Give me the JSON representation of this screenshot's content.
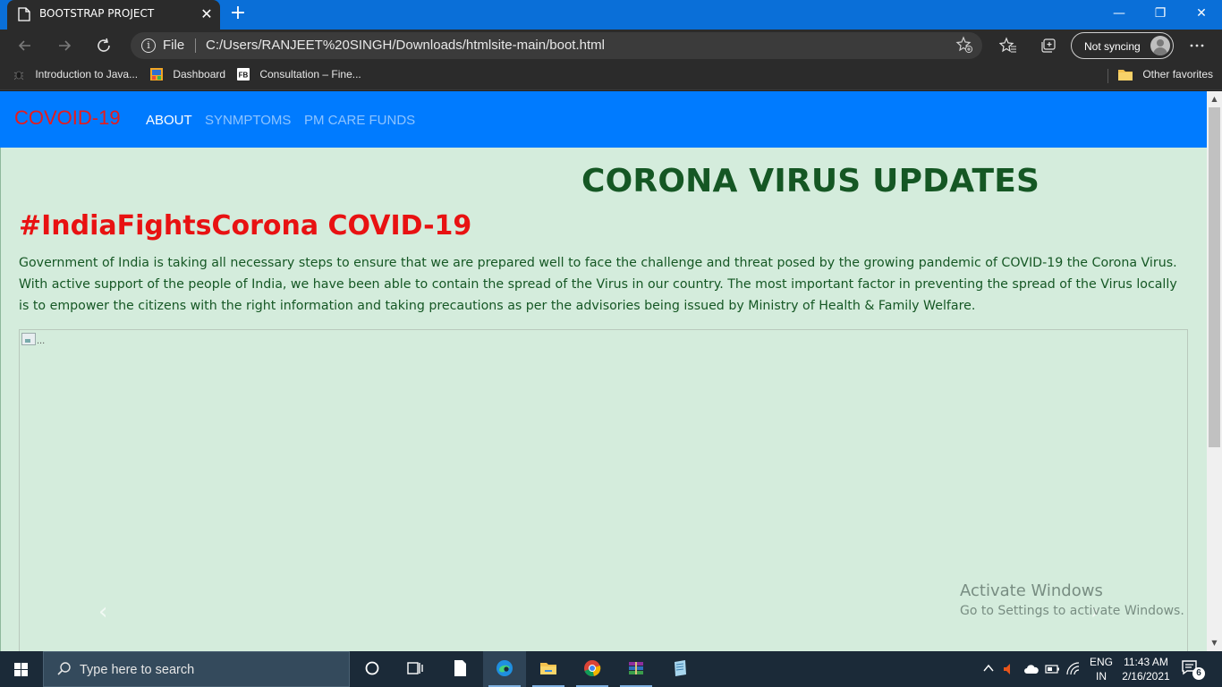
{
  "browser": {
    "tab": {
      "title": "BOOTSTRAP PROJECT",
      "close_glyph": "✕"
    },
    "new_tab_glyph": "+",
    "window_controls": {
      "minimize": "—",
      "restore": "❐",
      "close": "✕"
    },
    "address": {
      "scheme_label": "File",
      "url": "C:/Users/RANJEET%20SINGH/Downloads/htmlsite-main/boot.html"
    },
    "sync_label": "Not syncing",
    "favorites": [
      {
        "label": "Introduction to Java...",
        "icon": "bug-icon"
      },
      {
        "label": "Dashboard",
        "icon": "dashboard-icon"
      },
      {
        "label": "Consultation – Fine...",
        "icon": "fb-icon"
      }
    ],
    "other_favorites": "Other favorites"
  },
  "page": {
    "navbar": {
      "brand": "COVOID-19",
      "links": [
        "ABOUT",
        "SYNMPTOMS",
        "PM CARE FUNDS"
      ]
    },
    "title": "CORONA VIRUS UPDATES",
    "subtitle": "#IndiaFightsCorona COVID-19",
    "paragraph": "Government of India is taking all necessary steps to ensure that we are prepared well to face the challenge and threat posed by the growing pandemic of COVID-19 the Corona Virus. With active support of the people of India, we have been able to contain the spread of the Virus in our country. The most important factor in preventing the spread of the Virus locally is to empower the citizens with the right information and taking precautions as per the advisories being issued by Ministry of Health & Family Welfare.",
    "carousel": {
      "image_alt": "...",
      "prev_glyph": "‹",
      "next_glyph": "›"
    },
    "watermark": {
      "line1": "Activate Windows",
      "line2": "Go to Settings to activate Windows."
    }
  },
  "taskbar": {
    "search_placeholder": "Type here to search",
    "language": {
      "line1": "ENG",
      "line2": "IN"
    },
    "clock": {
      "time": "11:43 AM",
      "date": "2/16/2021"
    },
    "notification_count": "6"
  },
  "colors": {
    "navbar": "#007bff",
    "brand": "#e81b1b",
    "page_bg": "#d4ecdc",
    "title": "#155724",
    "subtitle": "#e81212"
  }
}
